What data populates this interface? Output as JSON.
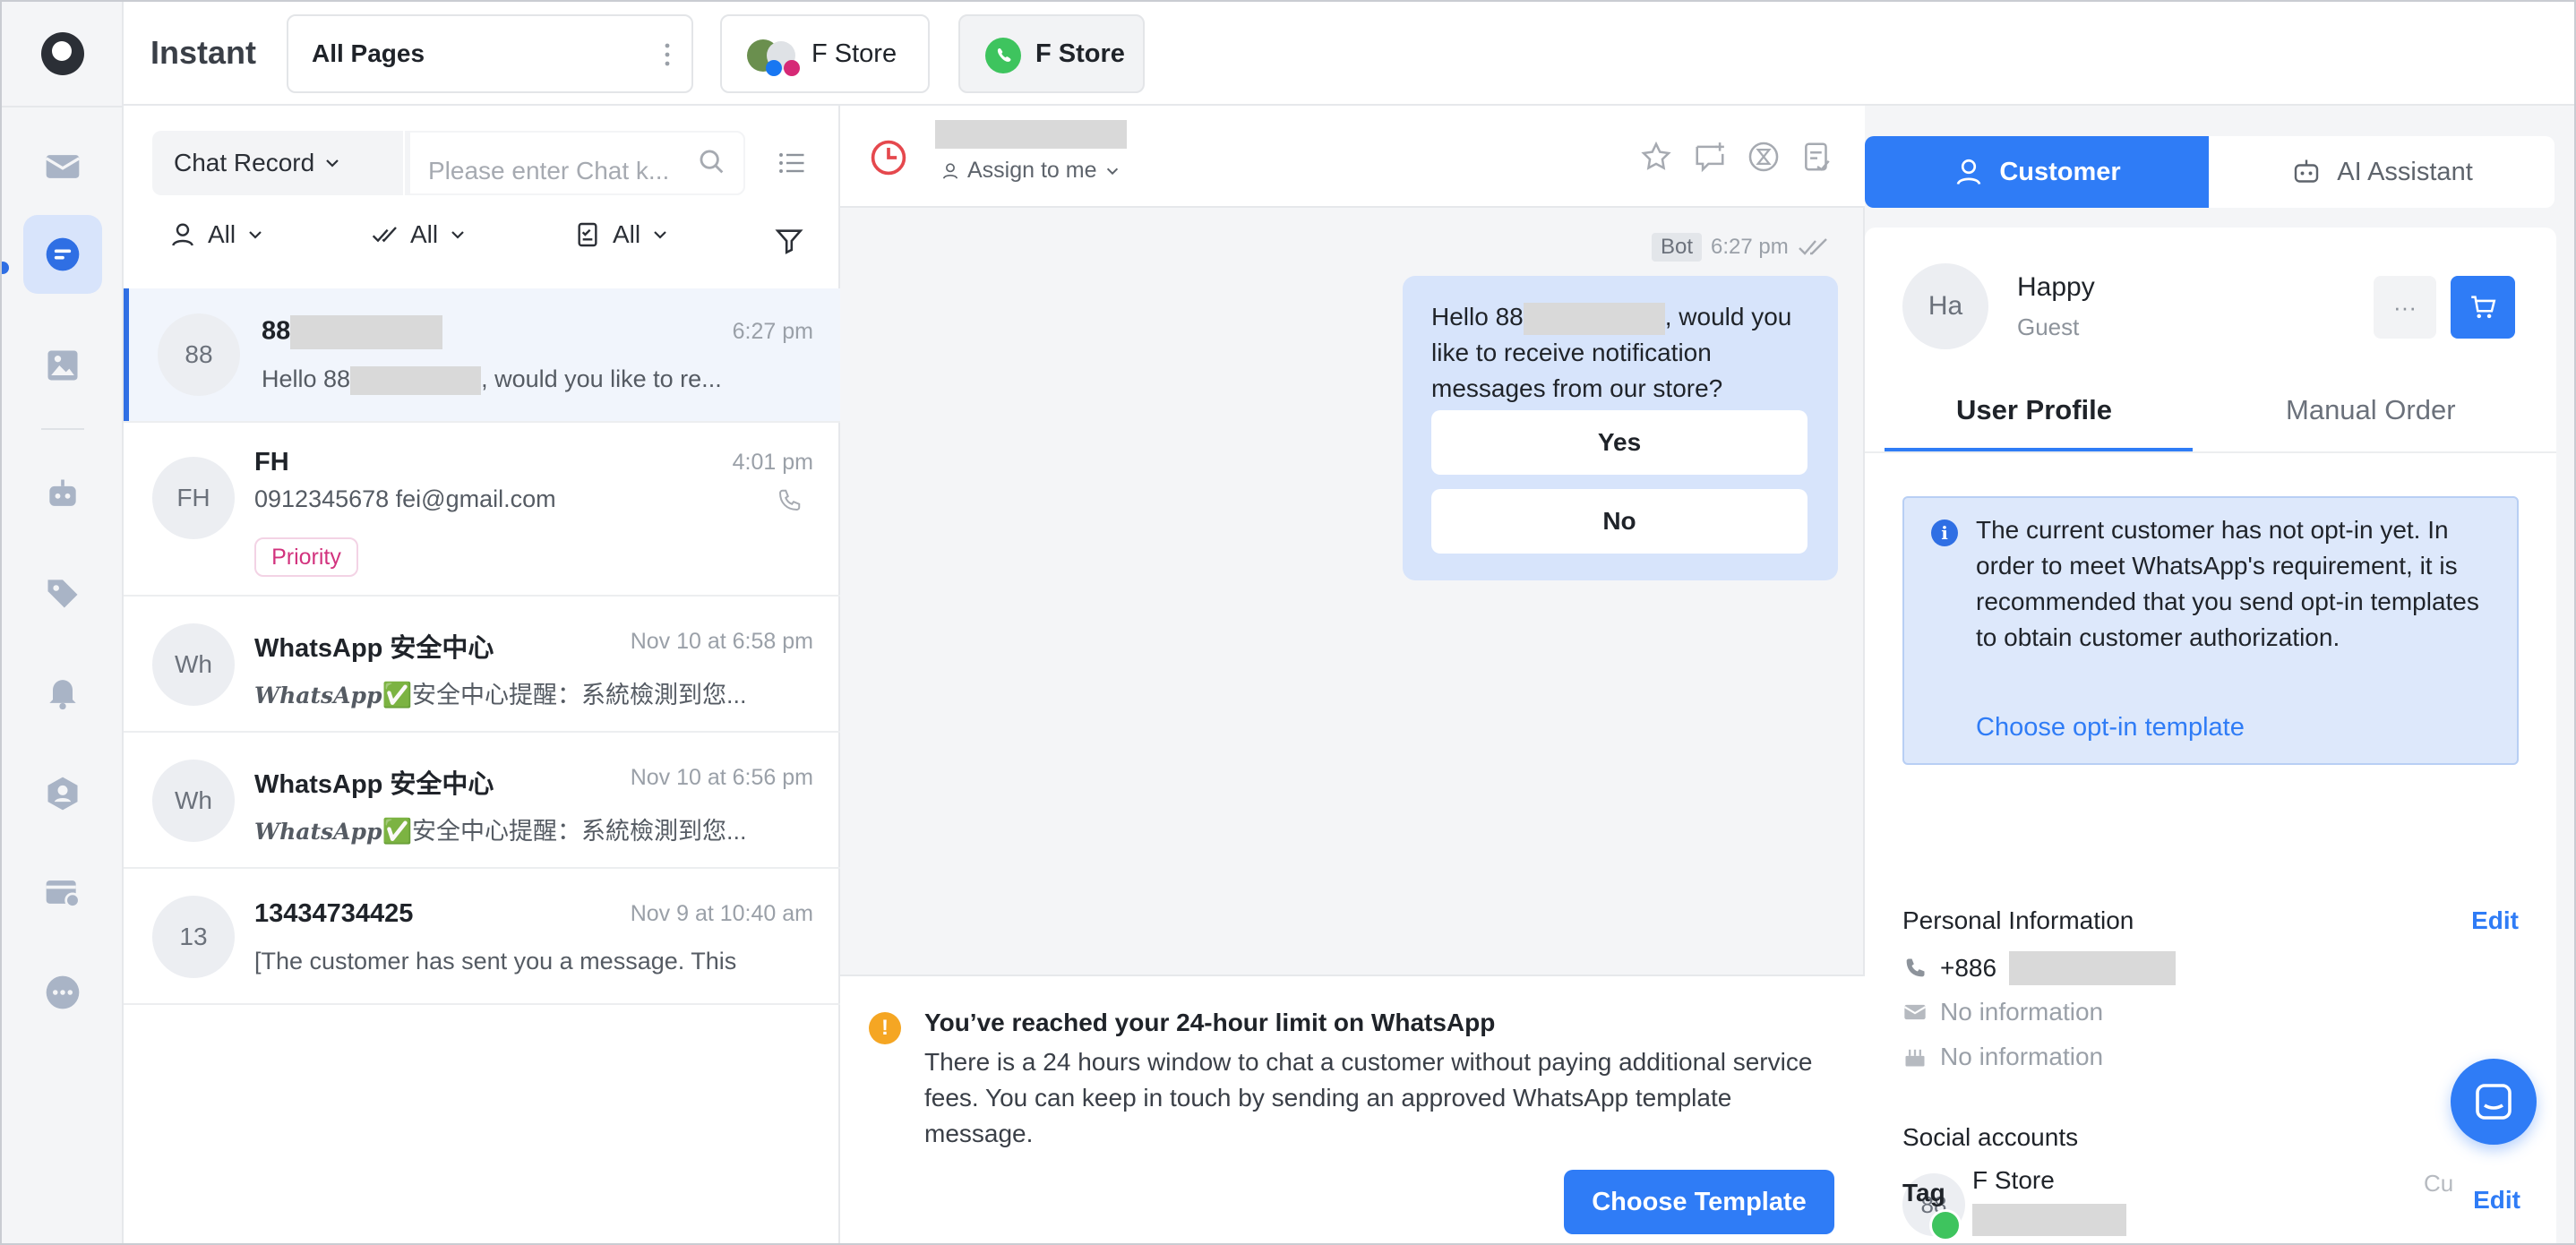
{
  "header": {
    "brand": "Instant",
    "pages_select": "All Pages",
    "store_tabs": [
      {
        "label": "F Store"
      },
      {
        "label": "F Store"
      }
    ]
  },
  "rail": {
    "icons": [
      "mail-icon",
      "chat-icon",
      "image-icon",
      "bot-icon",
      "tag-icon",
      "bell-icon",
      "contacts-icon",
      "card-settings-icon",
      "more-icon"
    ]
  },
  "list": {
    "record_select": "Chat Record",
    "search_placeholder": "Please enter Chat k...",
    "filters": [
      {
        "label": "All"
      },
      {
        "label": "All"
      },
      {
        "label": "All"
      }
    ],
    "chats": [
      {
        "avatar": "88",
        "name_prefix": "88",
        "time": "6:27 pm",
        "preview_prefix": "Hello 88",
        "preview_suffix": ", would you like to re..."
      },
      {
        "avatar": "FH",
        "name": "FH",
        "time": "4:01 pm",
        "preview": "0912345678 fei@gmail.com",
        "badge": "Priority"
      },
      {
        "avatar": "Wh",
        "name": "WhatsApp 安全中心",
        "time": "Nov 10 at 6:58 pm",
        "preview_brand": "WhatsApp",
        "preview": "✅安全中心提醒：系統檢測到您..."
      },
      {
        "avatar": "Wh",
        "name": "WhatsApp 安全中心",
        "time": "Nov 10 at 6:56 pm",
        "preview_brand": "WhatsApp",
        "preview": "✅安全中心提醒：系統檢測到您..."
      },
      {
        "avatar": "13",
        "name": "13434734425",
        "time": "Nov 9 at 10:40 am",
        "preview": "[The customer has sent you a message. This"
      }
    ]
  },
  "conversation": {
    "assign": "Assign to me",
    "message": {
      "sender_tag": "Bot",
      "time": "6:27 pm",
      "text_prefix": "Hello 88",
      "text_suffix": ", would you like to receive notification messages from our store?",
      "buttons": [
        "Yes",
        "No"
      ]
    },
    "limit": {
      "title": "You’ve reached your 24-hour limit on WhatsApp",
      "body": "There is a 24 hours window to chat a customer without paying additional service fees. You can keep in touch by sending an approved WhatsApp template message.",
      "button": "Choose Template"
    }
  },
  "customer_panel": {
    "tabs": [
      "Customer",
      "AI Assistant"
    ],
    "avatar": "Ha",
    "name": "Happy",
    "role": "Guest",
    "more": "···",
    "sub_tabs": [
      "User Profile",
      "Manual Order"
    ],
    "optin": {
      "text": "The current customer has not opt-in yet. In order to meet WhatsApp's requirement, it is recommended that you send opt-in templates to obtain customer authorization.",
      "link": "Choose opt-in template"
    },
    "personal": {
      "title": "Personal Information",
      "edit": "Edit",
      "phone_prefix": "+886",
      "email": "No information",
      "birthday": "No information"
    },
    "social": {
      "title": "Social accounts",
      "avatar": "88",
      "name": "F Store",
      "truncated": "Cu"
    },
    "tag": {
      "title": "Tag",
      "edit": "Edit"
    }
  },
  "colors": {
    "accent": "#2f7cf6",
    "priority": "#d2337e",
    "whatsapp": "#3ec45e",
    "warning": "#f5a623"
  }
}
